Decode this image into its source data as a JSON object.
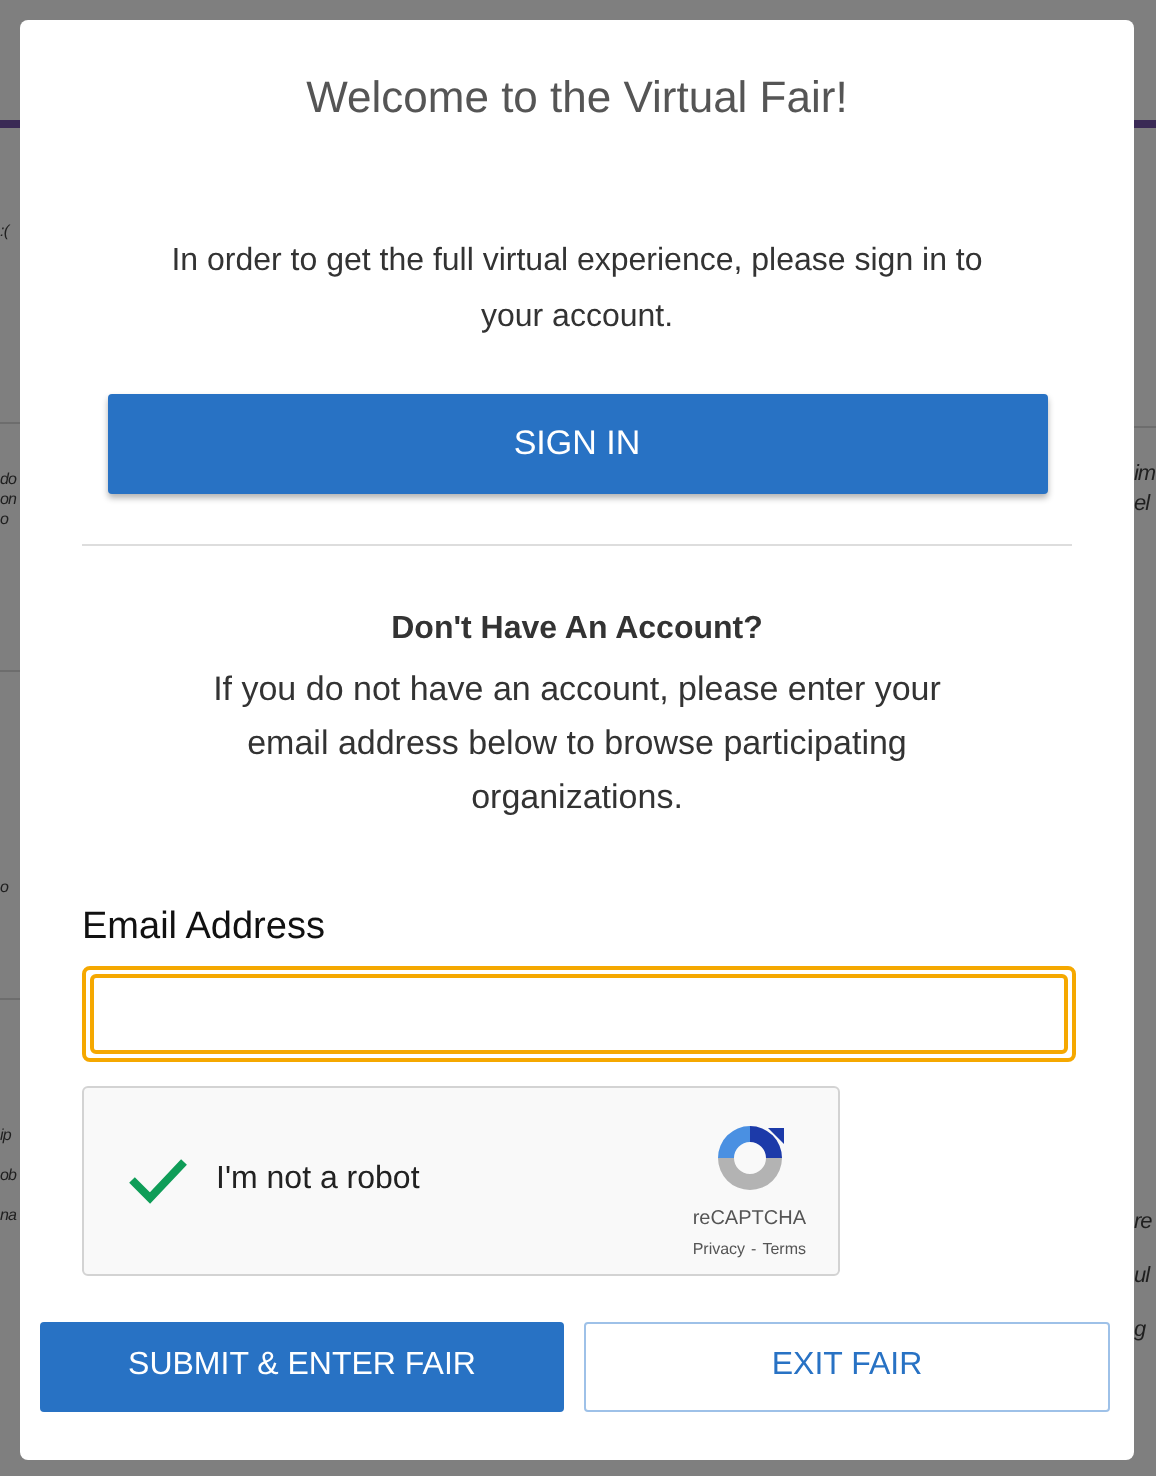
{
  "background": {
    "left_fragments": [
      ":(",
      "do",
      "on",
      "o",
      "o",
      "ip",
      "ob",
      "na"
    ],
    "right_fragments": [
      "im",
      "el",
      "re",
      "ul",
      "g"
    ]
  },
  "modal": {
    "title": "Welcome to the Virtual Fair!",
    "intro": "In order to get the full virtual experience, please sign in to your account.",
    "sign_in_button": "SIGN IN",
    "no_account_heading": "Don't Have An Account?",
    "no_account_text": "If you do not have an account, please enter your email address below to browse participating organizations.",
    "email_label": "Email Address",
    "email_focused": true,
    "captcha": {
      "label": "I'm not a robot",
      "checked": true,
      "brand": "reCAPTCHA",
      "privacy": "Privacy",
      "separator": "-",
      "terms": "Terms"
    },
    "submit_button": "SUBMIT & ENTER FAIR",
    "exit_button": "EXIT FAIR"
  }
}
